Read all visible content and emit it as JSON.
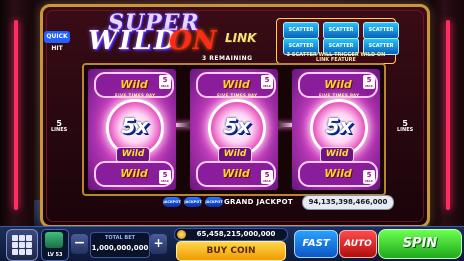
{
  "game": {
    "brand": "QUICK HIT",
    "title_line1": "SUPER",
    "title_wild": "WILD",
    "title_on": "ON",
    "title_link": "LINK",
    "remaining": "3 REMAINING"
  },
  "scatter_feature": {
    "badges": [
      "SCATTER",
      "SCATTER",
      "SCATTER",
      "SCATTER",
      "SCATTER",
      "SCATTER"
    ],
    "text_line1": "3 SCATTER WILL TRIGGER WILD ON",
    "text_line2": "LINK FEATURE"
  },
  "reels": [
    {
      "multiplier": "5x",
      "wild": "Wild",
      "ring": "FIVE TIMES PAY",
      "top_symbol": "Wild",
      "bottom_symbol": "Wild",
      "max_top": "5",
      "max_bottom": "5",
      "max_label": "MAX"
    },
    {
      "multiplier": "5x",
      "wild": "Wild",
      "ring": "FIVE TIMES PAY",
      "top_symbol": "Wild",
      "bottom_symbol": "Wild",
      "max_top": "5",
      "max_bottom": "5",
      "max_label": "MAX"
    },
    {
      "multiplier": "5x",
      "wild": "Wild",
      "ring": "FIVE TIMES PAY",
      "top_symbol": "Wild",
      "bottom_symbol": "Wild",
      "max_top": "5",
      "max_bottom": "5",
      "max_label": "MAX"
    }
  ],
  "side_lines": {
    "left_value": "5",
    "left_label": "LINES",
    "right_value": "5",
    "right_label": "LINES"
  },
  "jackpot": {
    "icons": [
      "JACKPOT",
      "JACKPOT",
      "JACKPOT"
    ],
    "label": "GRAND JACKPOT",
    "value": "94,135,398,466,000"
  },
  "controls": {
    "level": "LV 53",
    "total_bet_label": "TOTAL BET",
    "total_bet_value": "1,000,000,000",
    "bet_minus": "−",
    "bet_plus": "+",
    "coins": "65,458,215,000,000",
    "buy_coin": "BUY COIN",
    "fast": "FAST",
    "auto": "AUTO",
    "spin": "SPIN"
  },
  "colors": {
    "cabinet_border": "#c8973c",
    "spin_green": "#1ea81a",
    "auto_red": "#b00e0e",
    "fast_blue": "#0b56c4",
    "buy_gold": "#f09b00",
    "reel_pink": "#c23ebd"
  }
}
